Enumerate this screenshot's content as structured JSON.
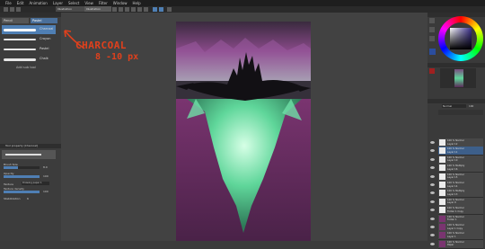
{
  "menu": [
    "File",
    "Edit",
    "Animation",
    "Layer",
    "Select",
    "View",
    "Filter",
    "Window",
    "Help"
  ],
  "document_tabs": [
    "Illustration",
    "Illustration"
  ],
  "tool_panel": {
    "tabs": [
      "Pencil",
      "Pastel"
    ],
    "brushes": [
      {
        "label": "Charcoal"
      },
      {
        "label": "Crayon"
      },
      {
        "label": "Pastel"
      },
      {
        "label": "Chalk"
      }
    ],
    "add_tool_label": "Add sub tool"
  },
  "tool_property": {
    "header": "Tool property [Charcoal]",
    "brush_size_label": "Brush Size",
    "brush_size_value": "8.0",
    "opacity_label": "Opacity",
    "opacity_value": "100",
    "texture_label": "Texture",
    "texture_value": "Drawing paper 1",
    "texture_density_label": "Texture density",
    "texture_density_value": "100",
    "stabilization_label": "Stabilization",
    "stabilization_value": "6"
  },
  "annotation": {
    "line1": "CHARCOAL",
    "line2": "8 -10 px",
    "color": "#e0401c"
  },
  "color_wheel": {
    "hue_ring": "rainbow",
    "square_color": "#3b2f8c"
  },
  "layer_panel": {
    "blend_mode": "Normal",
    "opacity": "100",
    "layers": [
      {
        "line1": "100 % Normal",
        "line2": "Layer 12"
      },
      {
        "line1": "100 % Normal",
        "line2": "Layer 11"
      },
      {
        "line1": "100 % Normal",
        "line2": "Layer 10"
      },
      {
        "line1": "100 % Multiply",
        "line2": "Layer 16"
      },
      {
        "line1": "100 % Normal",
        "line2": "Layer 15"
      },
      {
        "line1": "100 % Normal",
        "line2": "Layer 14"
      },
      {
        "line1": "100 % Multiply",
        "line2": "Layer 13"
      },
      {
        "line1": "100 % Normal",
        "line2": "Layer 9"
      },
      {
        "line1": "100 % Normal",
        "line2": "Folder 1 Copy"
      },
      {
        "line1": "100 % Normal",
        "line2": "Folder 1"
      },
      {
        "line1": "100 % Normal",
        "line2": "Layer 1 Copy"
      },
      {
        "line1": "100 % Normal",
        "line2": "Layer 1"
      },
      {
        "line1": "100 % Normal",
        "line2": "Paper"
      }
    ]
  }
}
